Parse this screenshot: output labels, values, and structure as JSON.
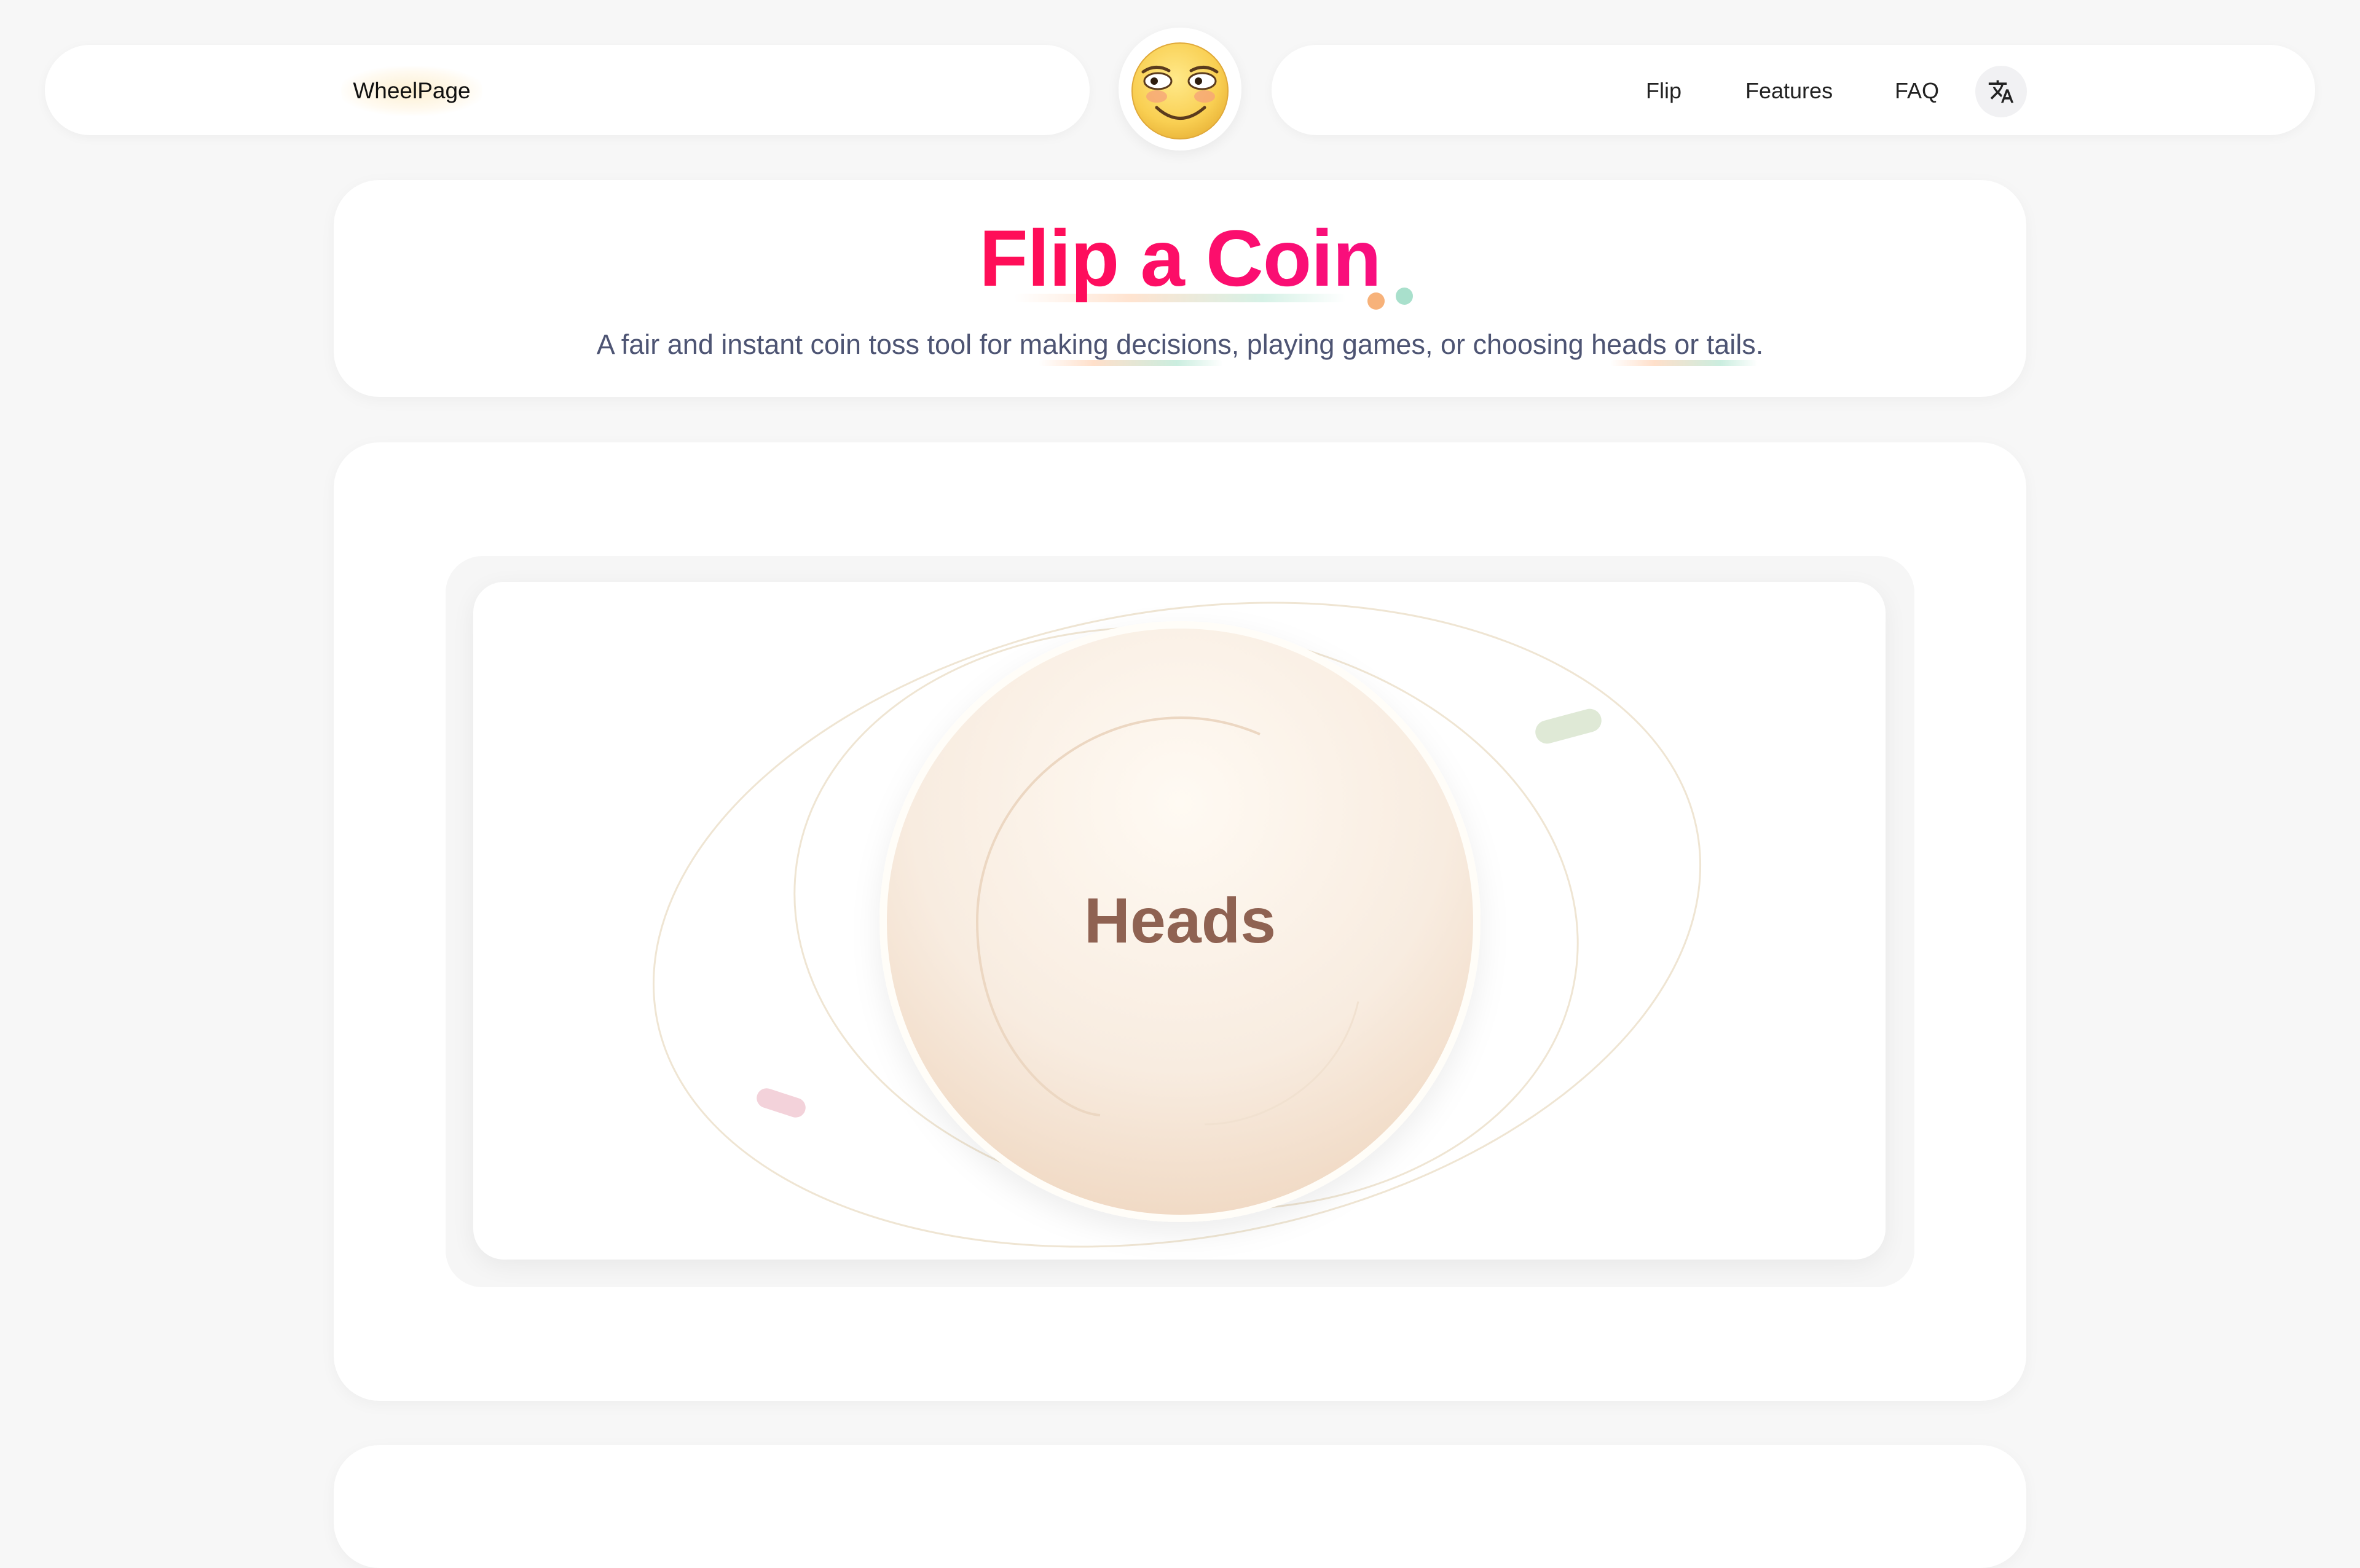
{
  "header": {
    "brand": "WheelPage",
    "nav": [
      {
        "label": "Flip"
      },
      {
        "label": "Features"
      },
      {
        "label": "FAQ"
      }
    ],
    "logo_icon": "smiley-face-icon",
    "language_icon": "translate-icon"
  },
  "hero": {
    "title": "Flip a Coin",
    "subtitle": "A fair and instant coin toss tool for making decisions, playing games, or choosing heads or tails."
  },
  "coin": {
    "result": "Heads"
  },
  "colors": {
    "title_gradient_start": "#ff1a36",
    "title_gradient_end": "#c21de6",
    "coin_text": "#8f6252",
    "subtitle_text": "#4d5473",
    "background": "#f7f7f7"
  }
}
